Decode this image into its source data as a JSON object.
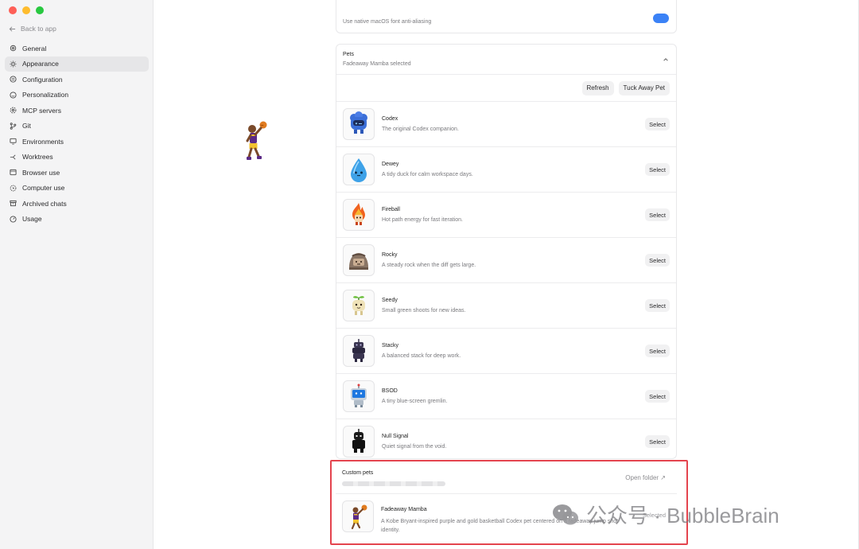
{
  "window": {
    "controls": [
      "close",
      "minimize",
      "zoom"
    ]
  },
  "sidebar": {
    "back_label": "Back to app",
    "items": [
      {
        "label": "General",
        "icon": "gear-icon",
        "active": false
      },
      {
        "label": "Appearance",
        "icon": "sun-icon",
        "active": true
      },
      {
        "label": "Configuration",
        "icon": "sliders-icon",
        "active": false
      },
      {
        "label": "Personalization",
        "icon": "smile-icon",
        "active": false
      },
      {
        "label": "MCP servers",
        "icon": "network-icon",
        "active": false
      },
      {
        "label": "Git",
        "icon": "git-branch-icon",
        "active": false
      },
      {
        "label": "Environments",
        "icon": "monitor-icon",
        "active": false
      },
      {
        "label": "Worktrees",
        "icon": "branch-icon",
        "active": false
      },
      {
        "label": "Browser use",
        "icon": "browser-icon",
        "active": false
      },
      {
        "label": "Computer use",
        "icon": "cursor-icon",
        "active": false
      },
      {
        "label": "Archived chats",
        "icon": "archive-icon",
        "active": false
      },
      {
        "label": "Usage",
        "icon": "gauge-icon",
        "active": false
      }
    ]
  },
  "font_setting": {
    "description": "Use native macOS font anti-aliasing"
  },
  "pets": {
    "title": "Pets",
    "subtitle": "Fadeaway Mamba selected",
    "refresh_label": "Refresh",
    "tuck_label": "Tuck Away Pet",
    "select_label": "Select",
    "list": [
      {
        "name": "Codex",
        "desc": "The original Codex companion."
      },
      {
        "name": "Dewey",
        "desc": "A tidy duck for calm workspace days."
      },
      {
        "name": "Fireball",
        "desc": "Hot path energy for fast iteration."
      },
      {
        "name": "Rocky",
        "desc": "A steady rock when the diff gets large."
      },
      {
        "name": "Seedy",
        "desc": "Small green shoots for new ideas."
      },
      {
        "name": "Stacky",
        "desc": "A balanced stack for deep work."
      },
      {
        "name": "BSOD",
        "desc": "A tiny blue-screen gremlin."
      },
      {
        "name": "Null Signal",
        "desc": "Quiet signal from the void."
      }
    ]
  },
  "custom_pets": {
    "title": "Custom pets",
    "open_folder_label": "Open folder ↗",
    "pet": {
      "name": "Fadeaway Mamba",
      "desc": "A Kobe Bryant-inspired purple and gold basketball Codex pet centered on a fadeaway jump shot identity.",
      "status": "Selected"
    }
  },
  "watermark": {
    "text": "公众号 · BubbleBrain"
  }
}
